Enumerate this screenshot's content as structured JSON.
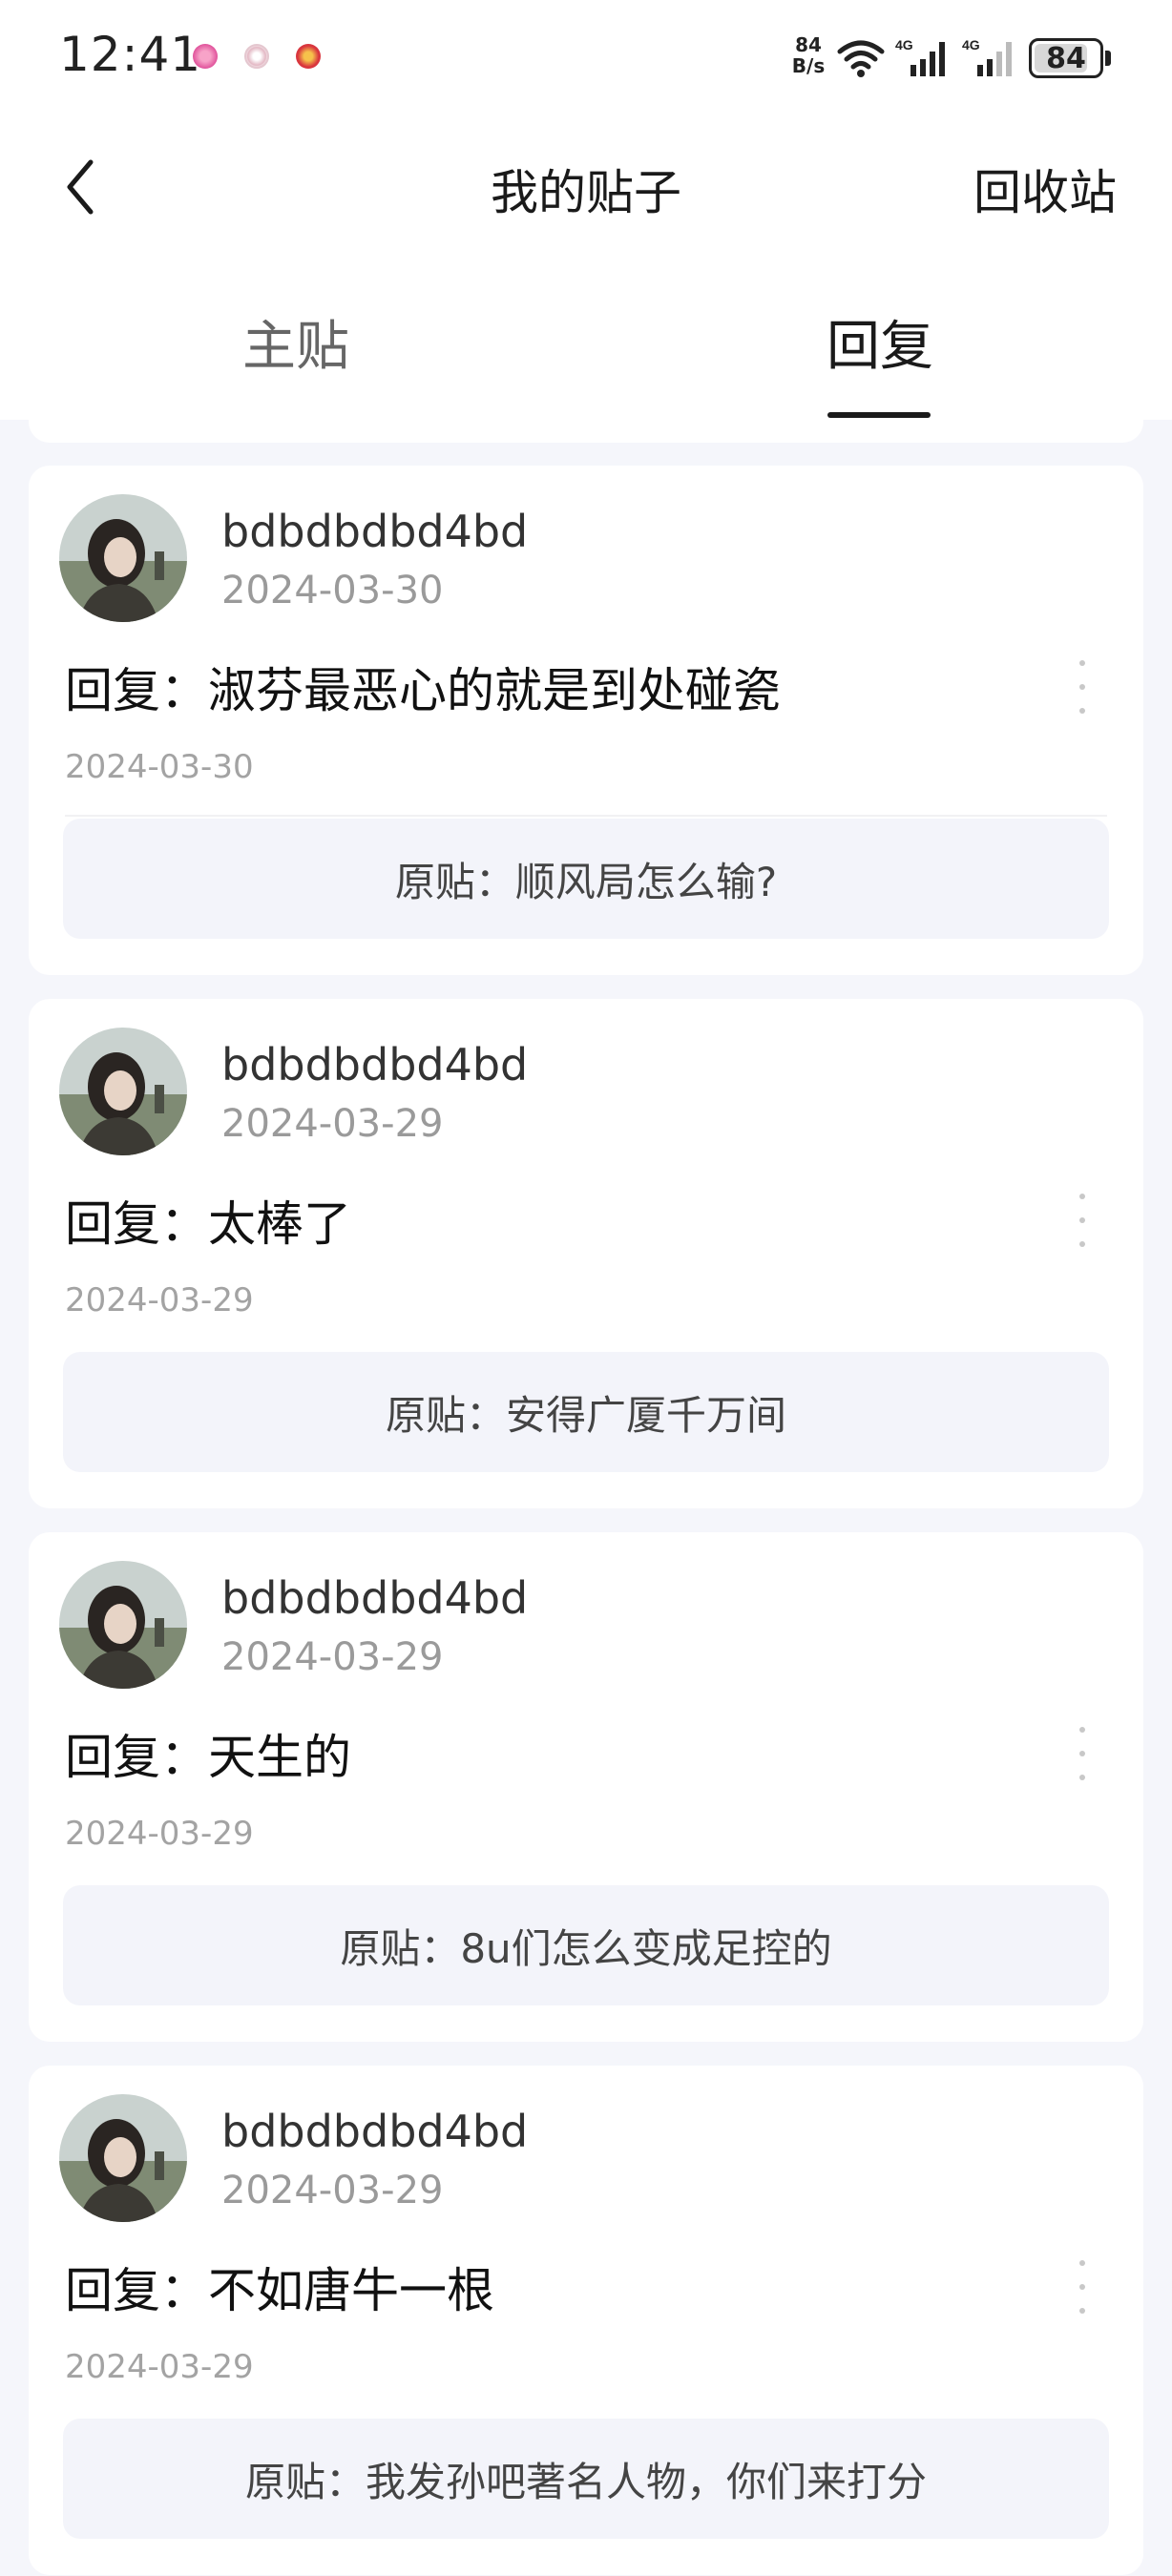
{
  "status_bar": {
    "time": "12:41",
    "net_speed_value": "84",
    "net_speed_unit": "B/s",
    "signal_1": "4G",
    "signal_2": "4G",
    "battery": "84"
  },
  "nav": {
    "back_icon": "chevron-left-icon",
    "title": "我的贴子",
    "action": "回收站"
  },
  "tabs": [
    {
      "label": "主贴",
      "active": false
    },
    {
      "label": "回复",
      "active": true
    }
  ],
  "posts": [
    {
      "username": "bdbdbdbd4bd",
      "user_date": "2024-03-30",
      "reply": "回复：淑芬最恶心的就是到处碰瓷",
      "reply_date": "2024-03-30",
      "original": "原贴：顺风局怎么输?"
    },
    {
      "username": "bdbdbdbd4bd",
      "user_date": "2024-03-29",
      "reply": "回复：太棒了",
      "reply_date": "2024-03-29",
      "original": "原贴：安得广厦千万间"
    },
    {
      "username": "bdbdbdbd4bd",
      "user_date": "2024-03-29",
      "reply": "回复：天生的",
      "reply_date": "2024-03-29",
      "original": "原贴：8u们怎么变成足控的"
    },
    {
      "username": "bdbdbdbd4bd",
      "user_date": "2024-03-29",
      "reply": "回复：不如唐牛一根",
      "reply_date": "2024-03-29",
      "original": "原贴：我发孙吧著名人物，你们来打分"
    }
  ],
  "colors": {
    "page_bg": "#f5f6fb",
    "card_bg": "#ffffff",
    "original_bg": "#f3f4fa",
    "text_primary": "#111111",
    "text_secondary": "#9a9a9a"
  }
}
